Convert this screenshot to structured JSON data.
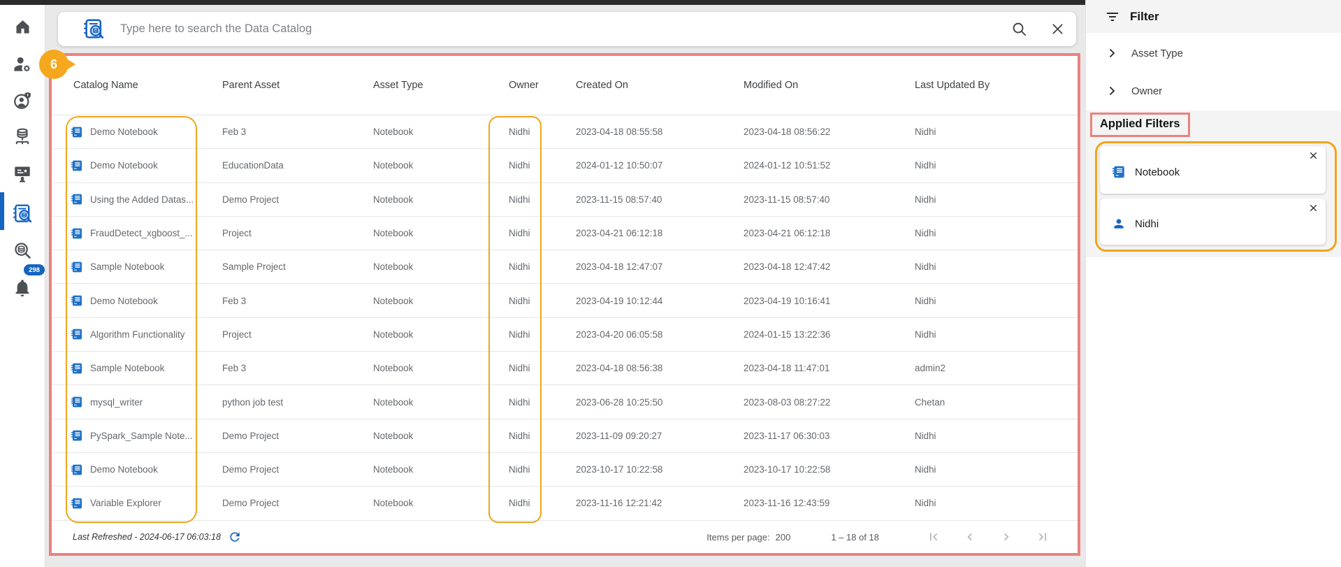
{
  "colors": {
    "accent_blue": "#1565c0",
    "annotation_pink": "#e8837f",
    "annotation_orange": "#efa51d"
  },
  "annotations": {
    "table_badge": "6"
  },
  "sidebar": {
    "icons": [
      "home-icon",
      "user-management-icon",
      "account-info-icon",
      "data-sources-icon",
      "training-icon",
      "data-catalog-icon",
      "catalog-search-icon",
      "notifications-icon"
    ],
    "active_item": "data-catalog",
    "notification_count": "298"
  },
  "search": {
    "placeholder": "Type here to search the Data Catalog"
  },
  "table": {
    "columns": [
      "Catalog Name",
      "Parent Asset",
      "Asset Type",
      "Owner",
      "Created On",
      "Modified On",
      "Last Updated By"
    ],
    "rows": [
      {
        "catalog_name": "Demo Notebook",
        "parent_asset": "Feb 3",
        "asset_type": "Notebook",
        "owner": "Nidhi",
        "created_on": "2023-04-18 08:55:58",
        "modified_on": "2023-04-18 08:56:22",
        "last_updated_by": "Nidhi"
      },
      {
        "catalog_name": "Demo Notebook",
        "parent_asset": "EducationData",
        "asset_type": "Notebook",
        "owner": "Nidhi",
        "created_on": "2024-01-12 10:50:07",
        "modified_on": "2024-01-12 10:51:52",
        "last_updated_by": "Nidhi"
      },
      {
        "catalog_name": "Using the Added Datas...",
        "parent_asset": "Demo Project",
        "asset_type": "Notebook",
        "owner": "Nidhi",
        "created_on": "2023-11-15 08:57:40",
        "modified_on": "2023-11-15 08:57:40",
        "last_updated_by": "Nidhi"
      },
      {
        "catalog_name": "FraudDetect_xgboost_...",
        "parent_asset": "Project",
        "asset_type": "Notebook",
        "owner": "Nidhi",
        "created_on": "2023-04-21 06:12:18",
        "modified_on": "2023-04-21 06:12:18",
        "last_updated_by": "Nidhi"
      },
      {
        "catalog_name": "Sample Notebook",
        "parent_asset": "Sample Project",
        "asset_type": "Notebook",
        "owner": "Nidhi",
        "created_on": "2023-04-18 12:47:07",
        "modified_on": "2023-04-18 12:47:42",
        "last_updated_by": "Nidhi"
      },
      {
        "catalog_name": "Demo Notebook",
        "parent_asset": "Feb 3",
        "asset_type": "Notebook",
        "owner": "Nidhi",
        "created_on": "2023-04-19 10:12:44",
        "modified_on": "2023-04-19 10:16:41",
        "last_updated_by": "Nidhi"
      },
      {
        "catalog_name": "Algorithm Functionality",
        "parent_asset": "Project",
        "asset_type": "Notebook",
        "owner": "Nidhi",
        "created_on": "2023-04-20 06:05:58",
        "modified_on": "2024-01-15 13:22:36",
        "last_updated_by": "Nidhi"
      },
      {
        "catalog_name": "Sample Notebook",
        "parent_asset": "Feb 3",
        "asset_type": "Notebook",
        "owner": "Nidhi",
        "created_on": "2023-04-18 08:56:38",
        "modified_on": "2023-04-18 11:47:01",
        "last_updated_by": "admin2"
      },
      {
        "catalog_name": "mysql_writer",
        "parent_asset": "python job test",
        "asset_type": "Notebook",
        "owner": "Nidhi",
        "created_on": "2023-06-28 10:25:50",
        "modified_on": "2023-08-03 08:27:22",
        "last_updated_by": "Chetan"
      },
      {
        "catalog_name": "PySpark_Sample Note...",
        "parent_asset": "Demo Project",
        "asset_type": "Notebook",
        "owner": "Nidhi",
        "created_on": "2023-11-09 09:20:27",
        "modified_on": "2023-11-17 06:30:03",
        "last_updated_by": "Nidhi"
      },
      {
        "catalog_name": "Demo Notebook",
        "parent_asset": "Demo Project",
        "asset_type": "Notebook",
        "owner": "Nidhi",
        "created_on": "2023-10-17 10:22:58",
        "modified_on": "2023-10-17 10:22:58",
        "last_updated_by": "Nidhi"
      },
      {
        "catalog_name": "Variable Explorer",
        "parent_asset": "Demo Project",
        "asset_type": "Notebook",
        "owner": "Nidhi",
        "created_on": "2023-11-16 12:21:42",
        "modified_on": "2023-11-16 12:43:59",
        "last_updated_by": "Nidhi"
      }
    ]
  },
  "footer": {
    "last_refreshed": "Last Refreshed - 2024-06-17 06:03:18",
    "items_per_page_label": "Items per page:",
    "items_per_page_value": "200",
    "range": "1 – 18 of 18"
  },
  "filter_panel": {
    "title": "Filter",
    "groups": [
      {
        "label": "Asset Type"
      },
      {
        "label": "Owner"
      }
    ],
    "applied_title": "Applied Filters",
    "chips": [
      {
        "icon": "notebook",
        "label": "Notebook"
      },
      {
        "icon": "person",
        "label": "Nidhi"
      }
    ]
  }
}
